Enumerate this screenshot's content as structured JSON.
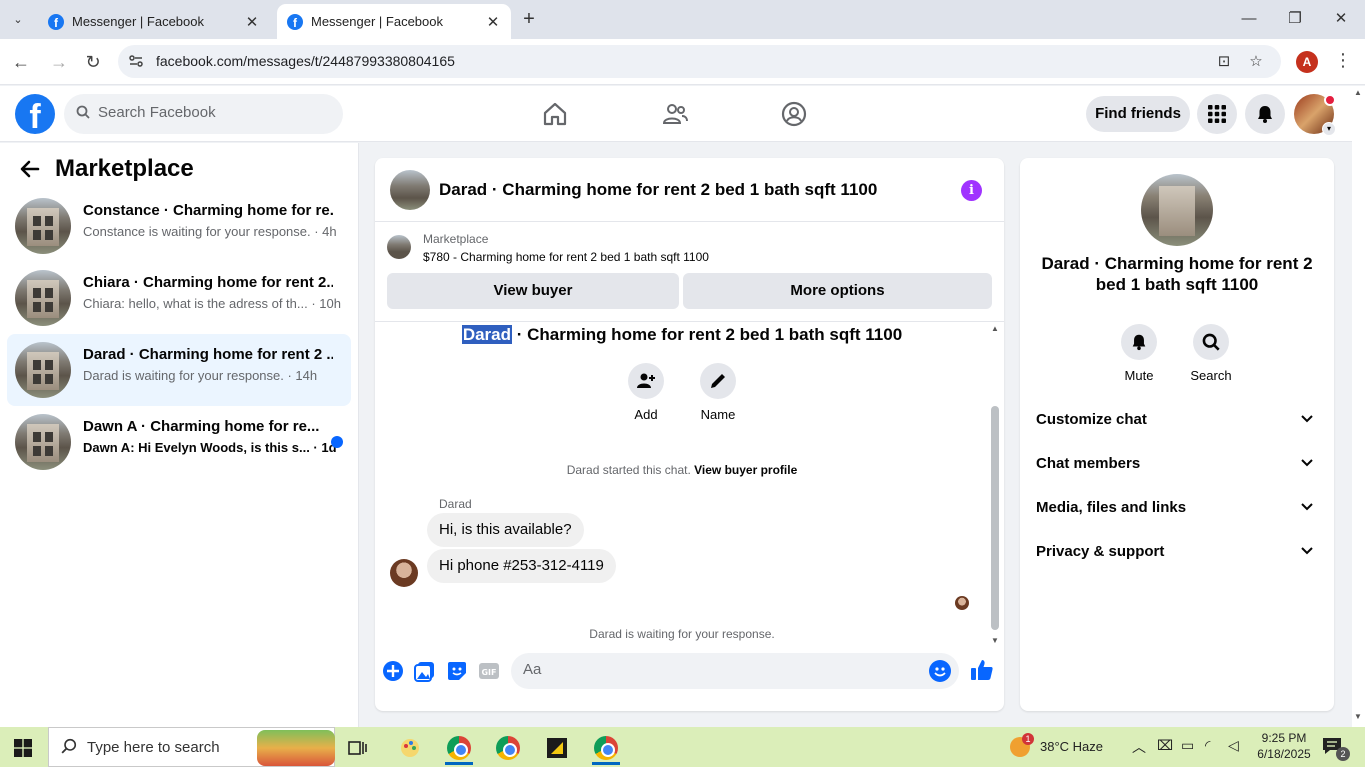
{
  "browser": {
    "tabs": [
      {
        "title": "Messenger | Facebook",
        "active": false
      },
      {
        "title": "Messenger | Facebook",
        "active": true
      }
    ],
    "url": "facebook.com/messages/t/24487993380804165",
    "profile_initial": "A"
  },
  "fb_header": {
    "search_placeholder": "Search Facebook",
    "find_friends_label": "Find friends",
    "nav_icons": [
      "home-icon",
      "friends-icon",
      "groups-icon"
    ]
  },
  "left_panel": {
    "title": "Marketplace",
    "conversations": [
      {
        "name": "Constance · Charming home for re...",
        "snippet": "Constance is waiting for your response. · 4h",
        "selected": false,
        "unread": false
      },
      {
        "name": "Chiara · Charming home for rent 2...",
        "snippet": "Chiara: hello, what is the adress of th... · 10h",
        "selected": false,
        "unread": false
      },
      {
        "name": "Darad · Charming home for rent 2 ...",
        "snippet": "Darad is waiting for your response. · 14h",
        "selected": true,
        "unread": false
      },
      {
        "name": "Dawn A · Charming home for re...",
        "snippet": "Dawn A: Hi Evelyn Woods, is this s... · 1d",
        "selected": false,
        "unread": true
      }
    ]
  },
  "chat": {
    "header_title": "Darad · Charming home for rent 2 bed 1 bath sqft 1100",
    "marketplace_label": "Marketplace",
    "listing": "$780 - Charming home for rent 2 bed 1 bath sqft 1100",
    "view_buyer_label": "View buyer",
    "more_options_label": "More options",
    "thread_title_highlight": "Darad",
    "thread_title_rest": " · Charming home for rent 2 bed 1 bath sqft 1100",
    "actions": [
      {
        "label": "Add",
        "icon": "add-person-icon"
      },
      {
        "label": "Name",
        "icon": "pencil-icon"
      }
    ],
    "started_text": "Darad started this chat.",
    "view_profile_link": "View buyer profile",
    "sender_name": "Darad",
    "messages": [
      {
        "text": "Hi, is this available?"
      },
      {
        "text": "Hi phone #253-312-4119"
      }
    ],
    "waiting_text": "Darad is waiting for your response.",
    "composer_placeholder": "Aa"
  },
  "right_panel": {
    "title": "Darad · Charming home for rent 2 bed 1 bath sqft 1100",
    "actions": [
      {
        "label": "Mute",
        "icon": "bell-icon"
      },
      {
        "label": "Search",
        "icon": "search-icon"
      }
    ],
    "sections": [
      "Customize chat",
      "Chat members",
      "Media, files and links",
      "Privacy & support"
    ]
  },
  "taskbar": {
    "search_placeholder": "Type here to search",
    "weather_badge": "1",
    "weather": "38°C  Haze",
    "time": "9:25 PM",
    "date": "6/18/2025",
    "notification_count": "2"
  },
  "colors": {
    "fb_blue": "#1877f2",
    "messenger_blue": "#0866ff",
    "info_purple": "#a033ff",
    "selected_row": "#ebf5ff",
    "taskbar": "#dbeeb9"
  }
}
